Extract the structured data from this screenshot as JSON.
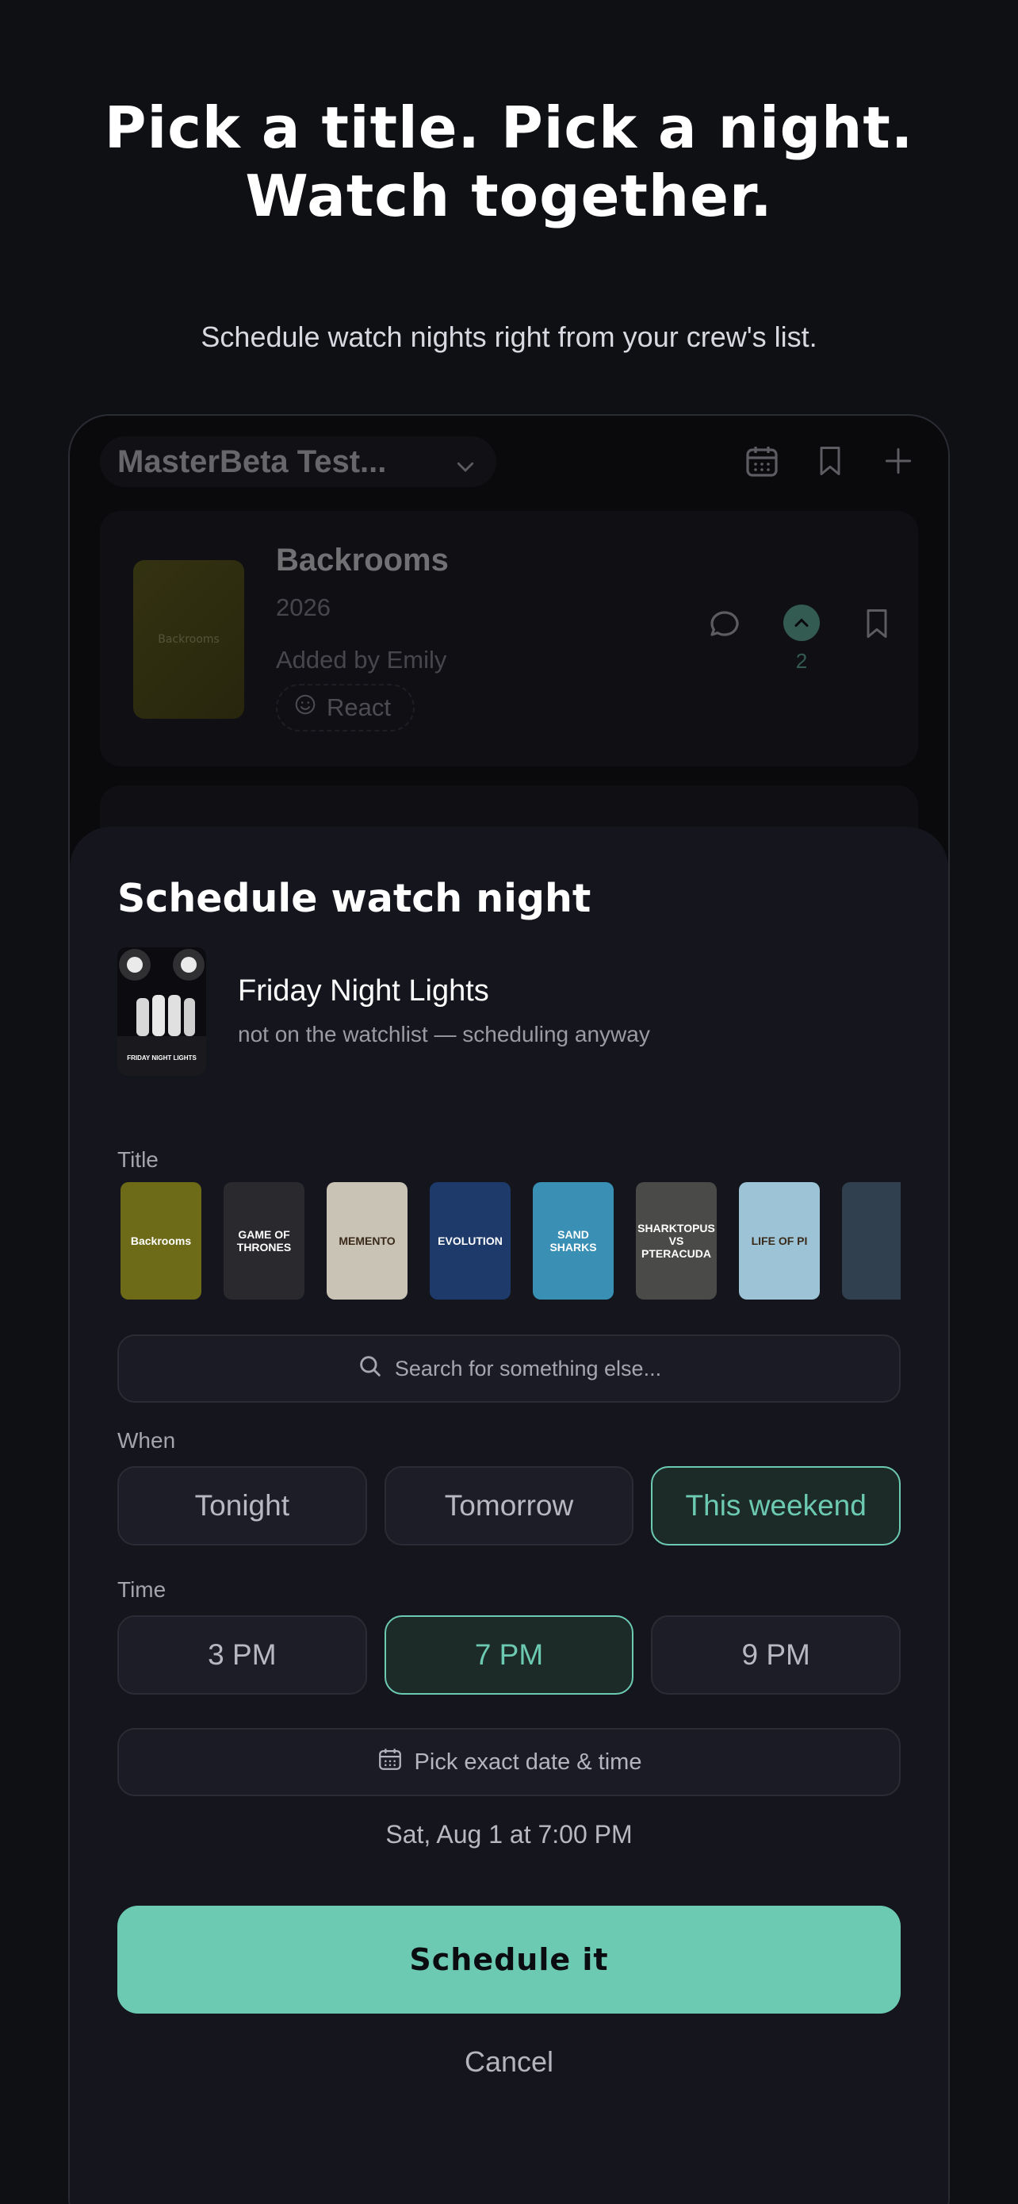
{
  "hero": {
    "headline": "Pick a title. Pick a night. Watch together.",
    "subhead": "Schedule watch nights right from your crew's list."
  },
  "app": {
    "crew_name": "MasterBeta Test...",
    "icons": [
      "calendar-icon",
      "bookmark-icon",
      "plus-icon"
    ],
    "card": {
      "title": "Backrooms",
      "year": "2026",
      "added_by": "Added by Emily",
      "poster_text": "Backrooms",
      "react_label": "React",
      "upvotes": "2"
    }
  },
  "sheet": {
    "title": "Schedule watch night",
    "selected": {
      "title": "Friday Night Lights",
      "subtitle": "not on the watchlist — scheduling anyway",
      "poster_text": "FRIDAY NIGHT LIGHTS"
    },
    "title_label": "Title",
    "posters": [
      {
        "text": "Backrooms",
        "bg": "#6d6a18"
      },
      {
        "text": "GAME OF THRONES",
        "bg": "#2a2a2e"
      },
      {
        "text": "MEMENTO",
        "bg": "#c9c3b6"
      },
      {
        "text": "EVOLUTION",
        "bg": "#1e3a6a"
      },
      {
        "text": "SAND SHARKS",
        "bg": "#3a8fb4"
      },
      {
        "text": "SHARKTOPUS VS PTERACUDA",
        "bg": "#4a4b48"
      },
      {
        "text": "LIFE OF PI",
        "bg": "#9cc3d6"
      },
      {
        "text": "",
        "bg": "#30404e"
      }
    ],
    "search_placeholder": "Search for something else...",
    "when_label": "When",
    "when_options": [
      "Tonight",
      "Tomorrow",
      "This weekend"
    ],
    "when_selected": "This weekend",
    "time_label": "Time",
    "time_options": [
      "3 PM",
      "7 PM",
      "9 PM"
    ],
    "time_selected": "7 PM",
    "exact_label": "Pick exact date & time",
    "summary": "Sat, Aug 1 at 7:00 PM",
    "primary_label": "Schedule it",
    "cancel_label": "Cancel"
  },
  "colors": {
    "accent": "#6ccab2",
    "background": "#0f1014",
    "sheet": "#14151d"
  }
}
